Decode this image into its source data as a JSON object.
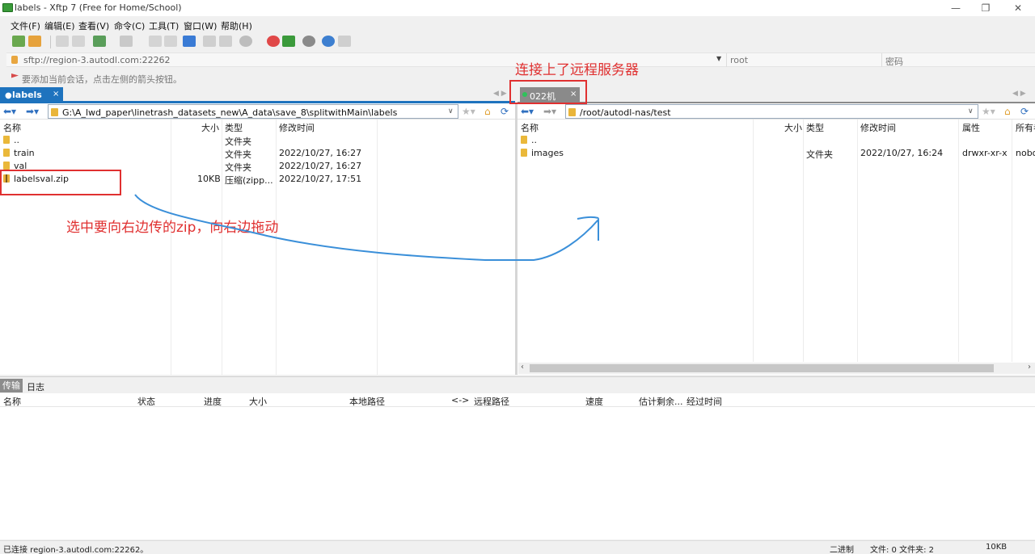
{
  "window": {
    "title": "labels - Xftp 7 (Free for Home/School)",
    "minimize": "—",
    "maximize": "❐",
    "close": "✕"
  },
  "menu": [
    "文件(F)",
    "编辑(E)",
    "查看(V)",
    "命令(C)",
    "工具(T)",
    "窗口(W)",
    "帮助(H)"
  ],
  "address": {
    "url": "sftp://region-3.autodl.com:22262",
    "user_placeholder": "root",
    "password_placeholder": "密码"
  },
  "hint": "要添加当前会话，点击左侧的箭头按钮。",
  "tabs": {
    "local": {
      "label": "labels",
      "close": "×"
    },
    "remote": {
      "label": "022机",
      "close": "×"
    }
  },
  "local": {
    "path": "G:\\A_lwd_paper\\linetrash_datasets_new\\A_data\\save_8\\splitwithMain\\labels",
    "columns": [
      "名称",
      "大小",
      "类型",
      "修改时间"
    ],
    "rows": [
      {
        "name": "..",
        "size": "",
        "type": "文件夹",
        "modified": ""
      },
      {
        "name": "train",
        "size": "",
        "type": "文件夹",
        "modified": "2022/10/27, 16:27"
      },
      {
        "name": "val",
        "size": "",
        "type": "文件夹",
        "modified": "2022/10/27, 16:27"
      },
      {
        "name": "labelsval.zip",
        "size": "10KB",
        "type": "压缩(zipp...",
        "modified": "2022/10/27, 17:51"
      }
    ]
  },
  "remote": {
    "path": "/root/autodl-nas/test",
    "columns": [
      "名称",
      "大小",
      "类型",
      "修改时间",
      "属性",
      "所有者"
    ],
    "rows": [
      {
        "name": "..",
        "size": "",
        "type": "",
        "modified": "",
        "attr": "",
        "owner": ""
      },
      {
        "name": "images",
        "size": "",
        "type": "文件夹",
        "modified": "2022/10/27, 16:24",
        "attr": "drwxr-xr-x",
        "owner": "nobody"
      }
    ]
  },
  "transfer": {
    "tabs": [
      "传输",
      "日志"
    ],
    "columns": [
      "名称",
      "状态",
      "进度",
      "大小",
      "本地路径",
      "<->",
      "远程路径",
      "速度",
      "估计剩余...",
      "经过时间"
    ]
  },
  "status": {
    "connection": "已连接 region-3.autodl.com:22262。",
    "mode": "二进制",
    "counts": "文件: 0  文件夹: 2",
    "size": "10KB"
  },
  "annotations": {
    "remote_note": "连接上了远程服务器",
    "drag_note": "选中要向右边传的zip，向右边拖动"
  },
  "colors": {
    "accent": "#1e73be",
    "annotation": "#e03030",
    "arrow": "#3a8fd9"
  }
}
